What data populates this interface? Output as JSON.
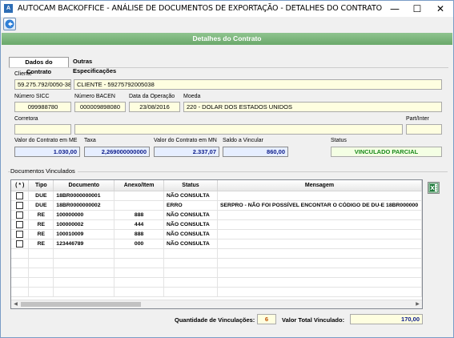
{
  "window": {
    "title": "AUTOCAM BACKOFFICE - ANÁLISE DE DOCUMENTOS DE EXPORTAÇÃO - DETALHES DO CONTRATO",
    "minimize": "—",
    "maximize": "☐",
    "close": "✕"
  },
  "header": {
    "title": "Detalhes do Contrato"
  },
  "tabs": [
    {
      "label": "Dados do Contrato"
    },
    {
      "label": "Outras Especificações"
    }
  ],
  "form": {
    "cliente_label": "Cliente",
    "cliente_cnpj": "59.275.792/0050-38",
    "cliente_nome": "CLIENTE - 59275792005038",
    "numero_sicc_label": "Número SICC",
    "numero_sicc": "099988780",
    "numero_bacen_label": "Número BACEN",
    "numero_bacen": "000009898080",
    "data_operacao_label": "Data da Operação",
    "data_operacao": "23/08/2016",
    "moeda_label": "Moeda",
    "moeda": "220 - DOLAR DOS ESTADOS UNIDOS",
    "corretora_label": "Corretora",
    "corretora_codigo": "",
    "corretora_nome": "",
    "part_inter_label": "Part/Inter",
    "part_inter": "",
    "valor_me_label": "Valor do Contrato em ME",
    "valor_me": "1.030,00",
    "taxa_label": "Taxa",
    "taxa": "2,269000000000",
    "valor_mn_label": "Valor do Contrato em MN",
    "valor_mn": "2.337,07",
    "saldo_label": "Saldo a Vincular",
    "saldo": "860,00",
    "status_label": "Status",
    "status": "VINCULADO PARCIAL"
  },
  "documentos": {
    "group_title": "Documentos Vinculados",
    "columns": [
      "( * )",
      "Tipo",
      "Documento",
      "Anexo/Item",
      "Status",
      "Mensagem"
    ],
    "rows": [
      {
        "tipo": "DUE",
        "documento": "18BR0000000001",
        "anexo": "",
        "status": "NÃO CONSULTA",
        "mensagem": ""
      },
      {
        "tipo": "DUE",
        "documento": "18BR0000000002",
        "anexo": "",
        "status": "ERRO",
        "mensagem": "SERPRO - NÃO FOI POSSÍVEL ENCONTAR O CÓDIGO DE DU-E 18BR000000"
      },
      {
        "tipo": "RE",
        "documento": "100000000",
        "anexo": "888",
        "status": "NÃO CONSULTA",
        "mensagem": ""
      },
      {
        "tipo": "RE",
        "documento": "100000002",
        "anexo": "444",
        "status": "NÃO CONSULTA",
        "mensagem": ""
      },
      {
        "tipo": "RE",
        "documento": "100010009",
        "anexo": "888",
        "status": "NÃO CONSULTA",
        "mensagem": ""
      },
      {
        "tipo": "RE",
        "documento": "123446789",
        "anexo": "000",
        "status": "NÃO CONSULTA",
        "mensagem": ""
      }
    ]
  },
  "footer": {
    "quantidade_label": "Quantidade de Vinculações:",
    "quantidade": "6",
    "valor_total_label": "Valor Total Vinculado:",
    "valor_total": "170,00"
  },
  "icons": {
    "app": "autocam-app-icon",
    "back": "back-arrow-icon",
    "export": "excel-export-icon"
  },
  "colors": {
    "header_band": "#7ab87a",
    "field_bg": "#fefee0",
    "value_blue": "#0a1a8a",
    "status_green": "#1a8a1a",
    "footer_orange": "#c05000"
  }
}
